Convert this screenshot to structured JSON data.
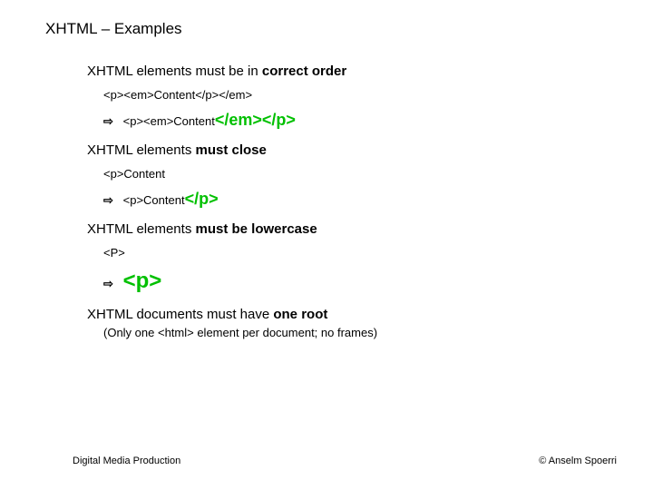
{
  "title": "XHTML – Examples",
  "rules": [
    {
      "heading_pre": "XHTML elements must be in ",
      "heading_bold": "correct order",
      "wrong": "<p><em>Content</p></em>",
      "right_pre": "<p><em>Content",
      "right_green": "</em></p>",
      "green_size": "big"
    },
    {
      "heading_pre": "XHTML elements ",
      "heading_bold": "must close",
      "wrong": "<p>Content",
      "right_pre": "<p>Content",
      "right_green": "</p>",
      "green_size": "big"
    },
    {
      "heading_pre": "XHTML elements ",
      "heading_bold": "must be lowercase",
      "wrong": "<P>",
      "right_pre": "",
      "right_green": "<p>",
      "green_size": "bigger"
    }
  ],
  "rule4": {
    "heading_pre": "XHTML documents must have ",
    "heading_bold": "one root",
    "note": "(Only one <html> element per document; no frames)"
  },
  "footer": {
    "left": "Digital Media Production",
    "right": "© Anselm Spoerri"
  }
}
